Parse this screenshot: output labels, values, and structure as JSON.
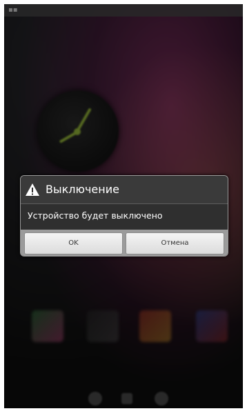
{
  "dialog": {
    "icon": "warning-icon",
    "title": "Выключение",
    "message": "Устройство будет выключено",
    "ok_label": "OK",
    "cancel_label": "Отмена"
  },
  "colors": {
    "dialog_background": "#2f2f2f",
    "button_bar": "#9b9b9b",
    "clock_hand": "#9cbf3c"
  }
}
